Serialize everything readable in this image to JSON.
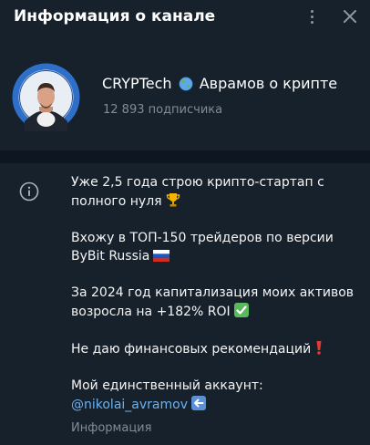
{
  "header": {
    "title": "Информация о канале"
  },
  "channel": {
    "name_prefix": "CRYPTech",
    "name_suffix": "Аврамов о крипте",
    "subscribers": "12 893 подписчика"
  },
  "description": {
    "line1": "Уже 2,5 года строю крипто-стартап с полного нуля",
    "line2": "Вхожу в ТОП-150 трейдеров по версии ByBit Russia",
    "line3": "За 2024 год капитализация моих активов возросла на +182% ROI",
    "line4": "Не даю финансовых рекомендаций",
    "line5": "Мой единственный аккаунт:",
    "mention": "@nikolai_avramov",
    "label": "Информация"
  },
  "colors": {
    "background": "#17212b",
    "separator": "#0e1621",
    "link": "#6ab2f2",
    "muted": "#7f8c99"
  }
}
